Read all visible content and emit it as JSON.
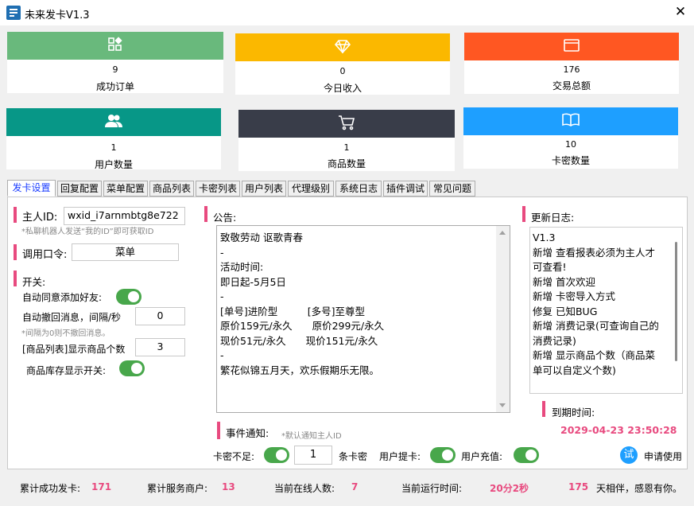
{
  "window": {
    "title": "未来发卡V1.3",
    "close_glyph": "✕"
  },
  "stats": [
    {
      "num": "9",
      "label": "成功订单",
      "color": "#69b97c",
      "icon": "apps-icon"
    },
    {
      "num": "0",
      "label": "今日收入",
      "color": "#fbb800",
      "icon": "diamond-icon"
    },
    {
      "num": "176",
      "label": "交易总额",
      "color": "#ff5722",
      "icon": "window-icon"
    },
    {
      "num": "1",
      "label": "用户数量",
      "color": "#079787",
      "icon": "users-icon"
    },
    {
      "num": "1",
      "label": "商品数量",
      "color": "#393d49",
      "icon": "cart-icon"
    },
    {
      "num": "10",
      "label": "卡密数量",
      "color": "#1e9fff",
      "icon": "book-icon"
    }
  ],
  "tabs": [
    "发卡设置",
    "回复配置",
    "菜单配置",
    "商品列表",
    "卡密列表",
    "用户列表",
    "代理级别",
    "系统日志",
    "插件调试",
    "常见问题"
  ],
  "settings": {
    "owner_label": "主人ID:",
    "owner_value": "wxid_i7arnmbtg8e722",
    "owner_hint": "*私聊机器人发送“我的ID”即可获取ID",
    "command_label": "调用口令:",
    "command_value": "菜单",
    "switch_label": "开关:",
    "auto_accept": "自动同意添加好友:",
    "auto_recall": "自动撤回消息，间隔/秒",
    "auto_recall_value": "0",
    "recall_hint": "*间隔为0则不撤回消息。",
    "show_count": "[商品列表]显示商品个数",
    "show_count_value": "3",
    "stock_switch": "商品库存显示开关:"
  },
  "notice": {
    "label": "公告:",
    "lines": [
      "致敬劳动 讴歌青春",
      "-",
      "活动时间:",
      "即日起-5月5日",
      "-",
      "[单号]进阶型　　　[多号]至尊型",
      "原价159元/永久　　原价299元/永久",
      "现价51元/永久　　现价151元/永久",
      "-",
      "繁花似锦五月天，欢乐假期乐无限。"
    ]
  },
  "changelog": {
    "label": "更新日志:",
    "lines": [
      "V1.3",
      "新增 查看报表必须为主人才",
      "可查看!",
      "新增 首次欢迎",
      "新增 卡密导入方式",
      "修复 已知BUG",
      "新增 消费记录(可查询自己的",
      "消费记录)",
      "新增 显示商品个数（商品菜",
      "单可以自定义个数)"
    ]
  },
  "expire": {
    "label": "到期时间:",
    "value": "2029-04-23 23:50:28"
  },
  "events": {
    "label": "事件通知:",
    "hint": "*默认通知主人ID",
    "card_short": "卡密不足:",
    "card_short_value": "1",
    "card_unit": "条卡密",
    "user_withdraw": "用户提卡:",
    "user_recharge": "用户充值:"
  },
  "trial": {
    "icon": "试",
    "label": "申请使用"
  },
  "status": {
    "total_label": "累计成功发卡:",
    "total_value": "171",
    "merchants_label": "累计服务商户:",
    "merchants_value": "13",
    "online_label": "当前在线人数:",
    "online_value": "7",
    "runtime_label": "当前运行时间:",
    "runtime_value": "20分2秒",
    "days_value": "175",
    "days_text": "天相伴，感恩有你。"
  }
}
